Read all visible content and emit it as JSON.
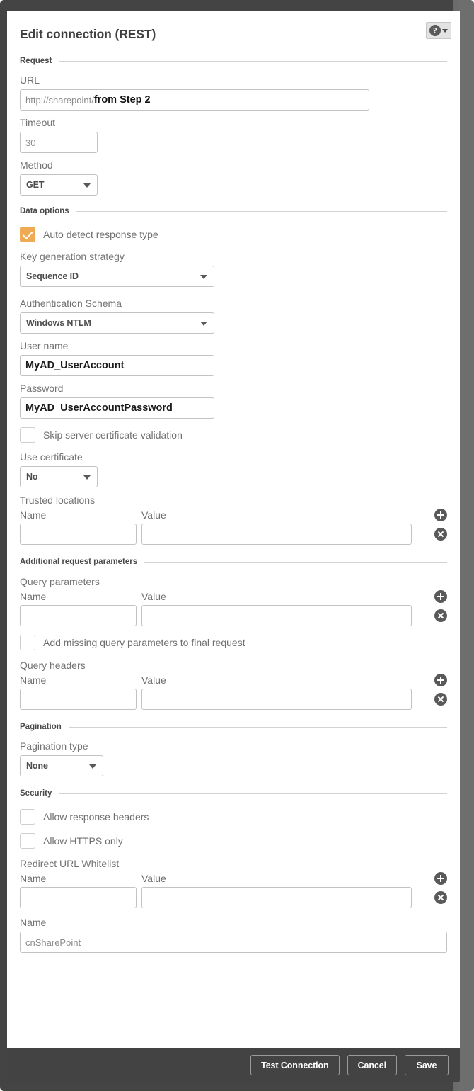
{
  "dialog": {
    "title": "Edit connection (REST)",
    "help_icon": "question-mark-icon",
    "help_caret": "chevron-down-icon"
  },
  "sections": {
    "request": {
      "heading": "Request",
      "url": {
        "label": "URL",
        "placeholder": "http://sharepoint/",
        "value": "from Step 2"
      },
      "timeout": {
        "label": "Timeout",
        "value": "30"
      },
      "method": {
        "label": "Method",
        "value": "GET"
      }
    },
    "data_options": {
      "heading": "Data options",
      "auto_detect": {
        "label": "Auto detect response type",
        "checked": true
      },
      "key_generation": {
        "label": "Key generation strategy",
        "value": "Sequence ID"
      },
      "auth_schema": {
        "label": "Authentication Schema",
        "value": "Windows NTLM"
      },
      "user_name": {
        "label": "User name",
        "value": "MyAD_UserAccount"
      },
      "password": {
        "label": "Password",
        "value": "MyAD_UserAccountPassword"
      },
      "skip_cert": {
        "label": "Skip server certificate validation",
        "checked": false
      },
      "use_certificate": {
        "label": "Use certificate",
        "value": "No"
      },
      "trusted_locations": {
        "label": "Trusted locations",
        "col_name": "Name",
        "col_value": "Value",
        "rows": [
          {
            "name": "",
            "value": ""
          }
        ]
      }
    },
    "additional_request_parameters": {
      "heading": "Additional request parameters",
      "query_parameters": {
        "label": "Query parameters",
        "col_name": "Name",
        "col_value": "Value",
        "rows": [
          {
            "name": "",
            "value": ""
          }
        ]
      },
      "add_missing": {
        "label": "Add missing query parameters to final request",
        "checked": false
      },
      "query_headers": {
        "label": "Query headers",
        "col_name": "Name",
        "col_value": "Value",
        "rows": [
          {
            "name": "",
            "value": ""
          }
        ]
      }
    },
    "pagination": {
      "heading": "Pagination",
      "pagination_type": {
        "label": "Pagination type",
        "value": "None"
      }
    },
    "security": {
      "heading": "Security",
      "allow_response_headers": {
        "label": "Allow response headers",
        "checked": false
      },
      "allow_https_only": {
        "label": "Allow HTTPS only",
        "checked": false
      },
      "redirect_whitelist": {
        "label": "Redirect URL Whitelist",
        "col_name": "Name",
        "col_value": "Value",
        "rows": [
          {
            "name": "",
            "value": ""
          }
        ]
      }
    },
    "connection_name": {
      "label": "Name",
      "value": "cnSharePoint"
    }
  },
  "footer": {
    "test_connection": "Test Connection",
    "cancel": "Cancel",
    "save": "Save"
  },
  "icons": {
    "add": "plus-circle-icon",
    "remove": "remove-circle-icon",
    "dropdown": "chevron-down-icon"
  },
  "colors": {
    "accent_checked": "#eeab54",
    "frame": "#444444",
    "footer": "#434343",
    "label_text": "#737373"
  }
}
